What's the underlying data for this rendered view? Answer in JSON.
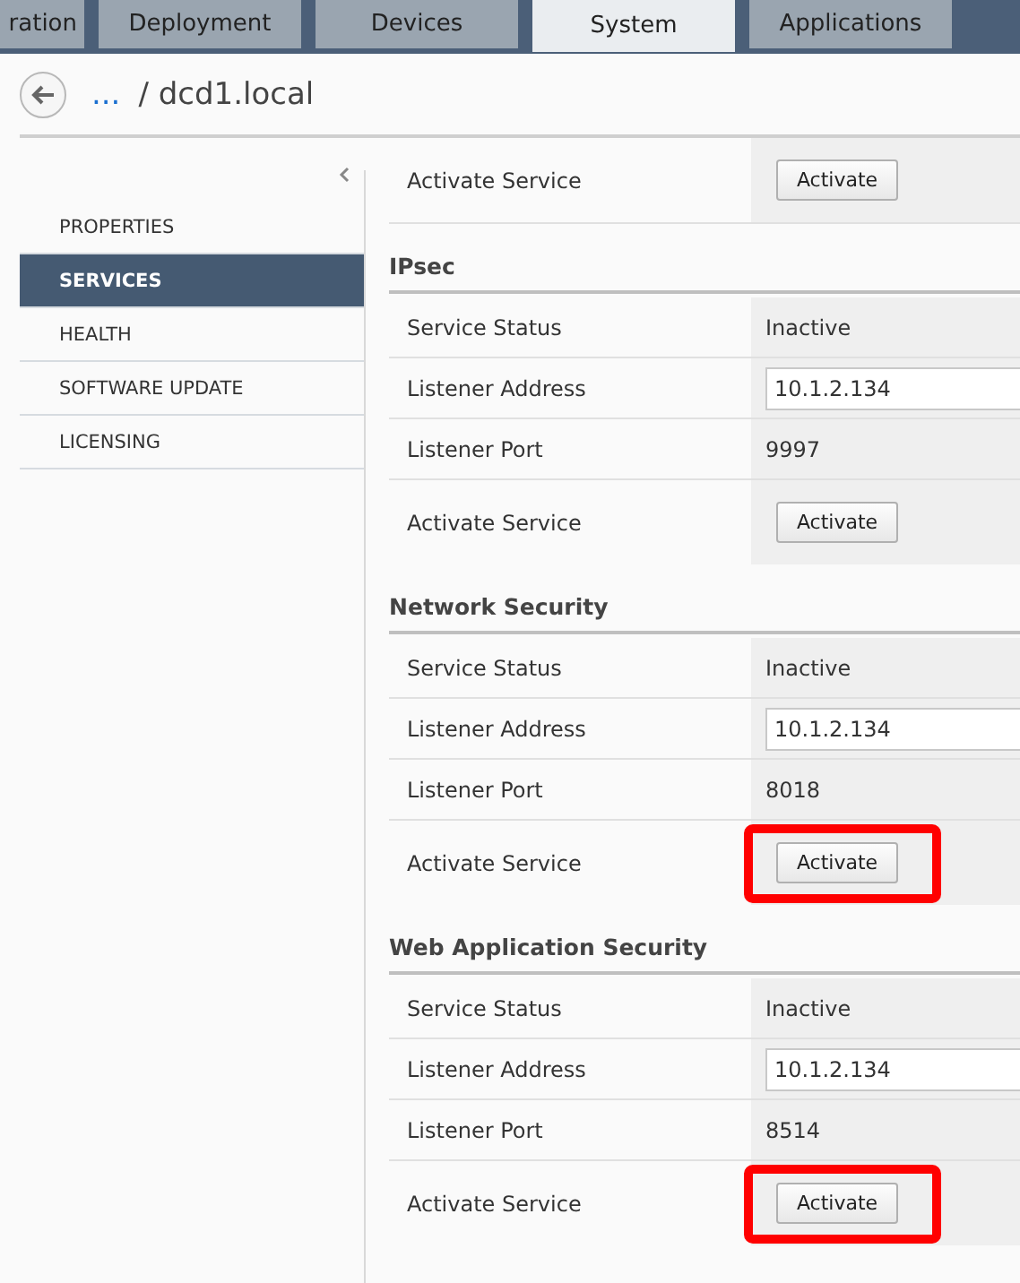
{
  "tabs": [
    {
      "label": "ration",
      "selected": false
    },
    {
      "label": "Deployment",
      "selected": false
    },
    {
      "label": "Devices",
      "selected": false
    },
    {
      "label": "System",
      "selected": true
    },
    {
      "label": "Applications",
      "selected": false
    }
  ],
  "breadcrumb": {
    "ellipsis": "...",
    "title": "/ dcd1.local"
  },
  "sidebar": {
    "items": [
      {
        "label": "PROPERTIES",
        "selected": false
      },
      {
        "label": "SERVICES",
        "selected": true
      },
      {
        "label": "HEALTH",
        "selected": false
      },
      {
        "label": "SOFTWARE UPDATE",
        "selected": false
      },
      {
        "label": "LICENSING",
        "selected": false
      }
    ]
  },
  "top_rows": [
    {
      "kind": "button",
      "label": "Activate Service",
      "button": "Activate",
      "highlighted": false
    }
  ],
  "sections": [
    {
      "title": "IPsec",
      "rows": [
        {
          "kind": "text",
          "label": "Service Status",
          "value": "Inactive"
        },
        {
          "kind": "input",
          "label": "Listener Address",
          "value": "10.1.2.134"
        },
        {
          "kind": "text",
          "label": "Listener Port",
          "value": "9997"
        },
        {
          "kind": "button",
          "label": "Activate Service",
          "button": "Activate",
          "highlighted": false
        }
      ]
    },
    {
      "title": "Network Security",
      "rows": [
        {
          "kind": "text",
          "label": "Service Status",
          "value": "Inactive"
        },
        {
          "kind": "input",
          "label": "Listener Address",
          "value": "10.1.2.134"
        },
        {
          "kind": "text",
          "label": "Listener Port",
          "value": "8018"
        },
        {
          "kind": "button",
          "label": "Activate Service",
          "button": "Activate",
          "highlighted": true
        }
      ]
    },
    {
      "title": "Web Application Security",
      "rows": [
        {
          "kind": "text",
          "label": "Service Status",
          "value": "Inactive"
        },
        {
          "kind": "input",
          "label": "Listener Address",
          "value": "10.1.2.134"
        },
        {
          "kind": "text",
          "label": "Listener Port",
          "value": "8514"
        },
        {
          "kind": "button",
          "label": "Activate Service",
          "button": "Activate",
          "highlighted": true
        }
      ]
    }
  ]
}
